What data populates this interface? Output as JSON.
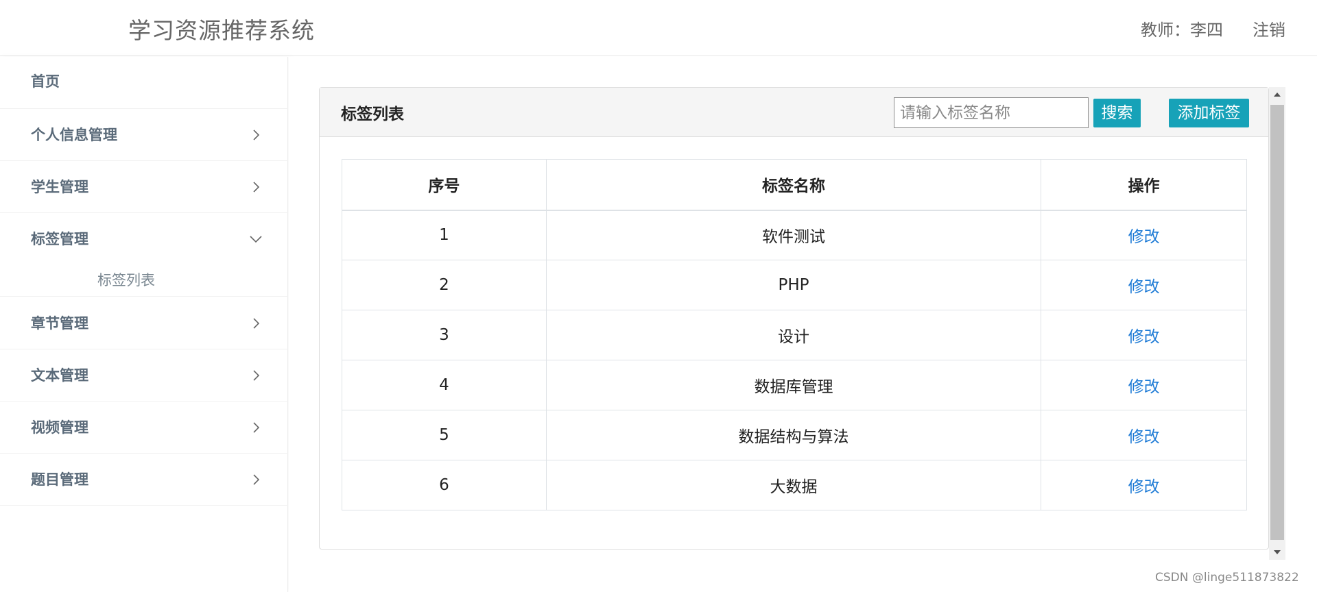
{
  "header": {
    "app_title": "学习资源推荐系统",
    "user_label": "教师：李四",
    "logout_label": "注销"
  },
  "sidebar": {
    "items": [
      {
        "label": "首页"
      },
      {
        "label": "个人信息管理"
      },
      {
        "label": "学生管理"
      },
      {
        "label": "标签管理",
        "submenu": [
          {
            "label": "标签列表"
          }
        ]
      },
      {
        "label": "章节管理"
      },
      {
        "label": "文本管理"
      },
      {
        "label": "视频管理"
      },
      {
        "label": "题目管理"
      }
    ]
  },
  "panel": {
    "title": "标签列表",
    "search_placeholder": "请输入标签名称",
    "search_button": "搜索",
    "add_button": "添加标签"
  },
  "table": {
    "headers": [
      "序号",
      "标签名称",
      "操作"
    ],
    "rows": [
      {
        "index": "1",
        "name": "软件测试",
        "action": "修改"
      },
      {
        "index": "2",
        "name": "PHP",
        "action": "修改"
      },
      {
        "index": "3",
        "name": "设计",
        "action": "修改"
      },
      {
        "index": "4",
        "name": "数据库管理",
        "action": "修改"
      },
      {
        "index": "5",
        "name": "数据结构与算法",
        "action": "修改"
      },
      {
        "index": "6",
        "name": "大数据",
        "action": "修改"
      }
    ]
  },
  "watermark": "CSDN @linge511873822",
  "colors": {
    "accent_button": "#17a2b8",
    "link": "#1e7bd6",
    "sidebar_text": "#5a6a79"
  },
  "icons": {
    "collapsed": "chevron-right-icon",
    "expanded": "chevron-down-icon"
  }
}
